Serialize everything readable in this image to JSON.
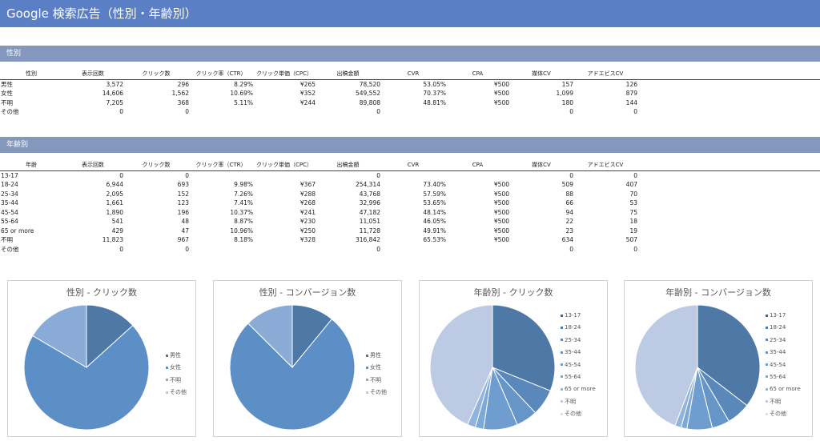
{
  "page_title": "Google 検索広告（性別・年齢別）",
  "gender_section": {
    "title": "性別",
    "headers": [
      "性別",
      "表示回数",
      "クリック数",
      "クリック率（CTR）",
      "クリック単価（CPC）",
      "出稿金額",
      "CVR",
      "CPA",
      "媒体CV",
      "アドエビスCV"
    ],
    "rows": [
      [
        "男性",
        "3,572",
        "296",
        "8.29%",
        "¥265",
        "78,520",
        "53.05%",
        "¥500",
        "157",
        "126"
      ],
      [
        "女性",
        "14,606",
        "1,562",
        "10.69%",
        "¥352",
        "549,552",
        "70.37%",
        "¥500",
        "1,099",
        "879"
      ],
      [
        "不明",
        "7,205",
        "368",
        "5.11%",
        "¥244",
        "89,808",
        "48.81%",
        "¥500",
        "180",
        "144"
      ],
      [
        "その他",
        "0",
        "0",
        "",
        "",
        "0",
        "",
        "",
        "0",
        "0"
      ]
    ]
  },
  "age_section": {
    "title": "年齢別",
    "headers": [
      "年齢",
      "表示回数",
      "クリック数",
      "クリック率（CTR）",
      "クリック単価（CPC）",
      "出稿金額",
      "CVR",
      "CPA",
      "媒体CV",
      "アドエビスCV"
    ],
    "rows": [
      [
        "13-17",
        "0",
        "0",
        "",
        "",
        "0",
        "",
        "",
        "0",
        "0"
      ],
      [
        "18-24",
        "6,944",
        "693",
        "9.98%",
        "¥367",
        "254,314",
        "73.40%",
        "¥500",
        "509",
        "407"
      ],
      [
        "25-34",
        "2,095",
        "152",
        "7.26%",
        "¥288",
        "43,768",
        "57.59%",
        "¥500",
        "88",
        "70"
      ],
      [
        "35-44",
        "1,661",
        "123",
        "7.41%",
        "¥268",
        "32,996",
        "53.65%",
        "¥500",
        "66",
        "53"
      ],
      [
        "45-54",
        "1,890",
        "196",
        "10.37%",
        "¥241",
        "47,182",
        "48.14%",
        "¥500",
        "94",
        "75"
      ],
      [
        "55-64",
        "541",
        "48",
        "8.87%",
        "¥230",
        "11,051",
        "46.05%",
        "¥500",
        "22",
        "18"
      ],
      [
        "65 or more",
        "429",
        "47",
        "10.96%",
        "¥250",
        "11,728",
        "49.91%",
        "¥500",
        "23",
        "19"
      ],
      [
        "不明",
        "11,823",
        "967",
        "8.18%",
        "¥328",
        "316,842",
        "65.53%",
        "¥500",
        "634",
        "507"
      ],
      [
        "その他",
        "0",
        "0",
        "",
        "",
        "0",
        "",
        "",
        "0",
        "0"
      ]
    ]
  },
  "chart_data": [
    {
      "type": "pie",
      "title": "性別 - クリック数",
      "categories": [
        "男性",
        "女性",
        "不明",
        "その他"
      ],
      "values": [
        296,
        1562,
        368,
        0
      ],
      "colors": [
        "#4e79a7",
        "#5b8fc6",
        "#8aabd6",
        "#bccbe3"
      ],
      "legend": "right"
    },
    {
      "type": "pie",
      "title": "性別 - コンバージョン数",
      "categories": [
        "男性",
        "女性",
        "不明",
        "その他"
      ],
      "values": [
        157,
        1099,
        180,
        0
      ],
      "colors": [
        "#4e79a7",
        "#5b8fc6",
        "#8aabd6",
        "#bccbe3"
      ],
      "legend": "right"
    },
    {
      "type": "pie",
      "title": "年齢別 - クリック数",
      "categories": [
        "13-17",
        "18-24",
        "25-34",
        "35-44",
        "45-54",
        "55-64",
        "65 or more",
        "不明",
        "その他"
      ],
      "values": [
        0,
        693,
        152,
        123,
        196,
        48,
        47,
        967,
        0
      ],
      "colors": [
        "#3f6894",
        "#4e79a7",
        "#5a88bb",
        "#6695c8",
        "#6f9dd0",
        "#7ea8d6",
        "#90b4dc",
        "#bccbe3",
        "#d6e0ee"
      ],
      "legend": "right"
    },
    {
      "type": "pie",
      "title": "年齢別 - コンバージョン数",
      "categories": [
        "13-17",
        "18-24",
        "25-34",
        "35-44",
        "45-54",
        "55-64",
        "65 or more",
        "不明",
        "その他"
      ],
      "values": [
        0,
        509,
        88,
        66,
        94,
        22,
        23,
        634,
        0
      ],
      "colors": [
        "#3f6894",
        "#4e79a7",
        "#5a88bb",
        "#6695c8",
        "#6f9dd0",
        "#7ea8d6",
        "#90b4dc",
        "#bccbe3",
        "#d6e0ee"
      ],
      "legend": "right"
    }
  ]
}
